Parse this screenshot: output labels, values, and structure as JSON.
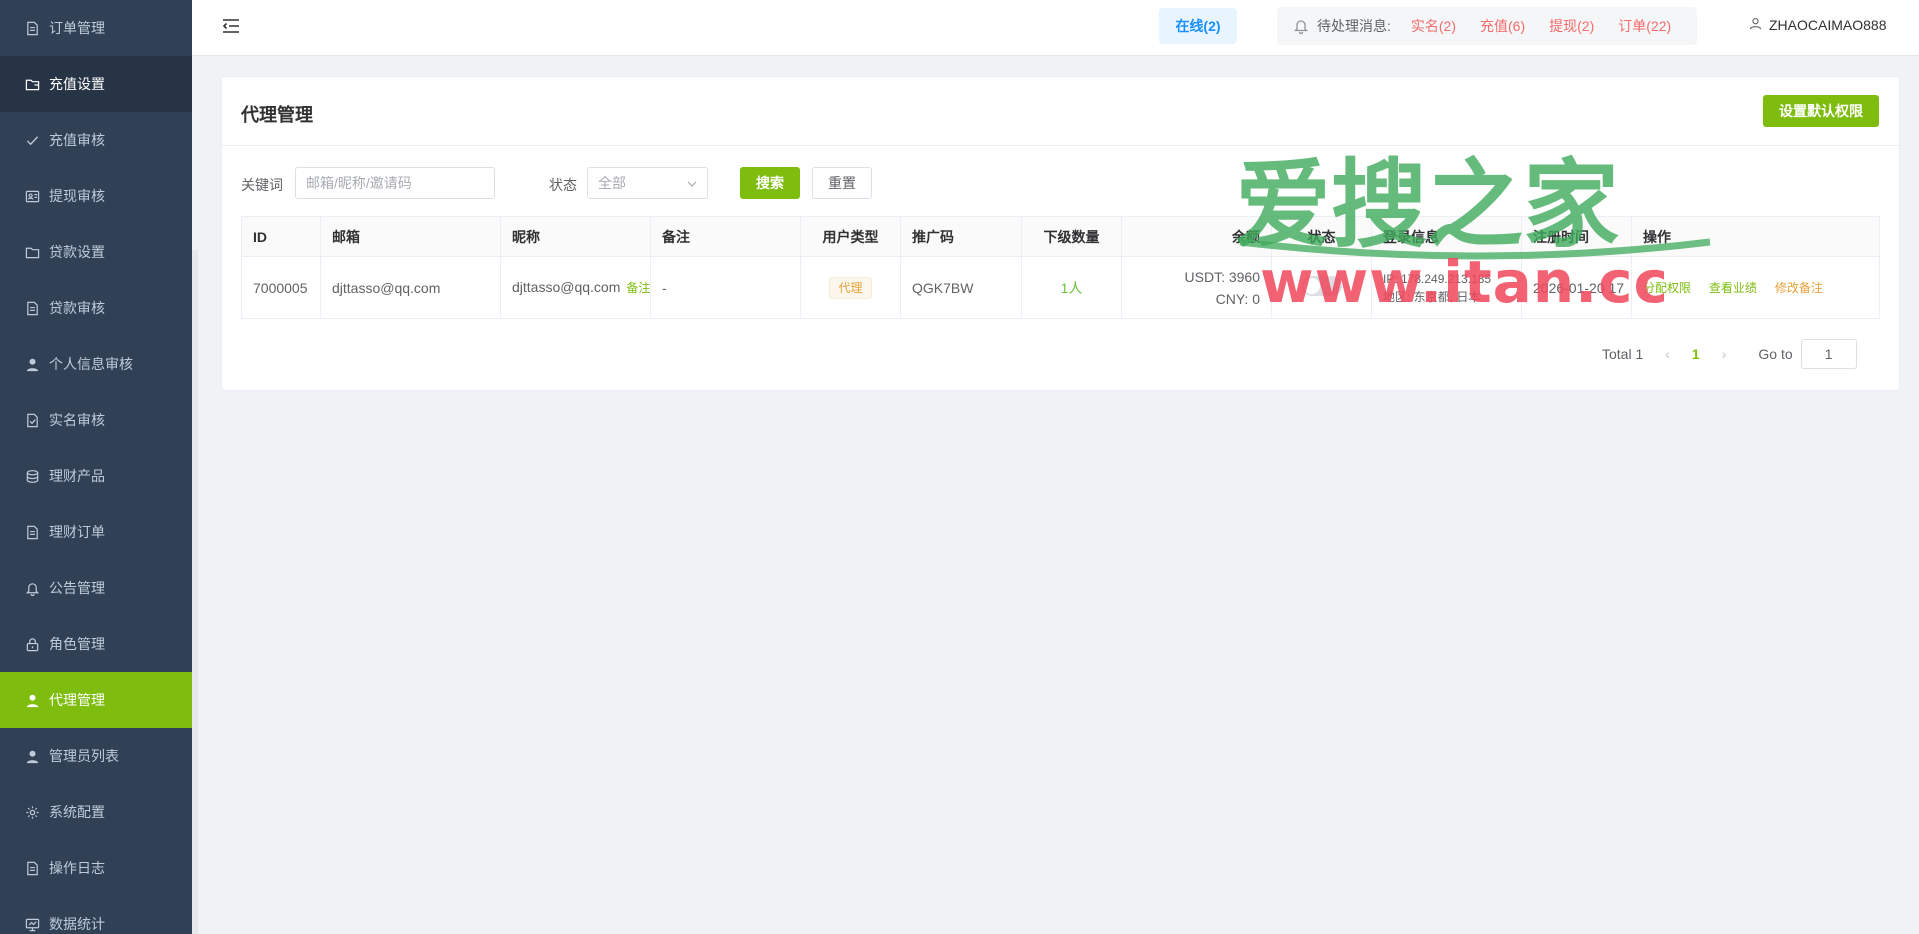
{
  "sidebar": {
    "items": [
      {
        "label": "订单管理",
        "icon": "document-icon"
      },
      {
        "label": "充值设置",
        "icon": "folder-icon"
      },
      {
        "label": "充值审核",
        "icon": "check-icon"
      },
      {
        "label": "提现审核",
        "icon": "id-card-icon"
      },
      {
        "label": "贷款设置",
        "icon": "folder-icon"
      },
      {
        "label": "贷款审核",
        "icon": "document-icon"
      },
      {
        "label": "个人信息审核",
        "icon": "user-icon"
      },
      {
        "label": "实名审核",
        "icon": "document-check-icon"
      },
      {
        "label": "理财产品",
        "icon": "coins-icon"
      },
      {
        "label": "理财订单",
        "icon": "document-icon"
      },
      {
        "label": "公告管理",
        "icon": "bell-icon"
      },
      {
        "label": "角色管理",
        "icon": "lock-icon"
      },
      {
        "label": "代理管理",
        "icon": "user-icon"
      },
      {
        "label": "管理员列表",
        "icon": "user-icon"
      },
      {
        "label": "系统配置",
        "icon": "gear-icon"
      },
      {
        "label": "操作日志",
        "icon": "document-icon"
      },
      {
        "label": "数据统计",
        "icon": "monitor-icon"
      }
    ],
    "active_index": 12
  },
  "header": {
    "online": "在线(2)",
    "pending_label": "待处理消息:",
    "pending": [
      "实名(2)",
      "充值(6)",
      "提现(2)",
      "订单(22)"
    ],
    "username": "ZHAOCAIMAO888"
  },
  "page": {
    "title": "代理管理",
    "default_perm_button": "设置默认权限"
  },
  "filter": {
    "keyword_label": "关键词",
    "keyword_placeholder": "邮箱/昵称/邀请码",
    "status_label": "状态",
    "status_value": "全部",
    "search_button": "搜索",
    "reset_button": "重置"
  },
  "table": {
    "headers": [
      "ID",
      "邮箱",
      "昵称",
      "备注",
      "用户类型",
      "推广码",
      "下级数量",
      "余额",
      "状态",
      "登录信息",
      "注册时间",
      "操作"
    ],
    "rows": [
      {
        "id": "7000005",
        "email": "djttasso@qq.com",
        "nickname": "djttasso@qq.com",
        "nickname_link": "备注",
        "remark": "-",
        "user_type": "代理",
        "promo_code": "QGK7BW",
        "sub_count": "1人",
        "balance_usdt": "USDT: 3960",
        "balance_cny": "CNY: 0",
        "login_ip": "IP: 178.249.213.185",
        "login_region": "地区: 东京都, 日本",
        "reg_time": "2026-01-20 17",
        "ops": [
          "分配权限",
          "查看业绩",
          "修改备注"
        ]
      }
    ]
  },
  "pagination": {
    "total": "Total 1",
    "page": "1",
    "goto_label": "Go to",
    "goto_value": "1"
  },
  "watermark": {
    "cn": "爱搜之家",
    "en": "www.itan.cc"
  },
  "colors": {
    "sidebar_bg": "#304156",
    "accent": "#7ebd0e",
    "danger": "#f56c6c",
    "warning": "#e6a23c"
  }
}
